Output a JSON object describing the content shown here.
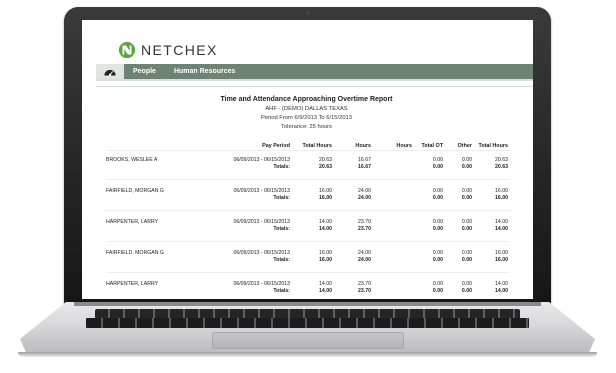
{
  "app": {
    "brand": "NETCHEX"
  },
  "nav": {
    "items": [
      "People",
      "Human Resources"
    ]
  },
  "report": {
    "title": "Time and Attendance Approaching Overtime Report",
    "company": "AHF - (DEMO) DALLAS TEXAS",
    "period": "Period From 6/9/2013 To 6/15/2013",
    "tolerance": "Tolerance: 25 hours",
    "columns": [
      "Pay Period",
      "Total Hours",
      "Hours",
      "Hours",
      "Total OT",
      "Other",
      "Total Hours"
    ],
    "rows": [
      {
        "name": "BROOKS, WESLEE A",
        "period": "06/09/2013 - 06/15/2013",
        "vals": [
          "20.63",
          "16.67",
          "",
          "0.00",
          "0.00",
          "20.63"
        ],
        "totals_label": "Totals:",
        "totals": [
          "20.63",
          "16.67",
          "",
          "0.00",
          "0.00",
          "20.63"
        ]
      },
      {
        "name": "FAIRFIELD, MORGAN G",
        "period": "06/09/2013 - 06/15/2013",
        "vals": [
          "16.00",
          "24.00",
          "",
          "0.00",
          "0.00",
          "16.00"
        ],
        "totals_label": "Totals:",
        "totals": [
          "16.00",
          "24.00",
          "",
          "0.00",
          "0.00",
          "16.00"
        ]
      },
      {
        "name": "HARPENTER, LARRY",
        "period": "06/09/2013 - 06/15/2013",
        "vals": [
          "14.00",
          "23.70",
          "",
          "0.00",
          "0.00",
          "14.00"
        ],
        "totals_label": "Totals:",
        "totals": [
          "14.00",
          "23.70",
          "",
          "0.00",
          "0.00",
          "14.00"
        ]
      },
      {
        "name": "FAIRFIELD, MORGAN G",
        "period": "06/09/2013 - 06/15/2013",
        "vals": [
          "16.00",
          "24.00",
          "",
          "0.00",
          "0.00",
          "16.00"
        ],
        "totals_label": "Totals:",
        "totals": [
          "16.00",
          "24.00",
          "",
          "0.00",
          "0.00",
          "16.00"
        ]
      },
      {
        "name": "HARPENTER, LARRY",
        "period": "06/09/2013 - 06/15/2013",
        "vals": [
          "14.00",
          "23.70",
          "",
          "0.00",
          "0.00",
          "14.00"
        ],
        "totals_label": "Totals:",
        "totals": [
          "14.00",
          "23.70",
          "",
          "0.00",
          "0.00",
          "14.00"
        ]
      }
    ]
  },
  "colors": {
    "brand_green": "#6f8375",
    "logo_green": "#5aa83a"
  }
}
